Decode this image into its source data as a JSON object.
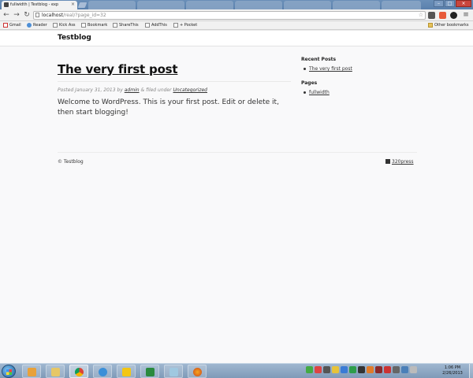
{
  "browser": {
    "active_tab": {
      "title": "fullwidth | Testblog - exp",
      "close": "×"
    },
    "window_controls": {
      "minimize": "–",
      "maximize": "□",
      "close": "×"
    },
    "nav": {
      "back": "←",
      "forward": "→",
      "reload": "↻"
    },
    "omnibox": {
      "host": "localhost",
      "path": "/real/?page_id=32",
      "star": "☆"
    },
    "bookmarks": [
      {
        "label": "Gmail",
        "icon": "gmail-icon"
      },
      {
        "label": "Reader",
        "icon": "reader-icon"
      },
      {
        "label": "Kick Ass",
        "icon": "page-icon"
      },
      {
        "label": "Bookmark",
        "icon": "page-icon"
      },
      {
        "label": "ShareThis",
        "icon": "page-icon"
      },
      {
        "label": "AddThis",
        "icon": "page-icon"
      },
      {
        "label": "+ Pocket",
        "icon": "page-icon"
      }
    ],
    "other_bookmarks": "Other bookmarks"
  },
  "site": {
    "title": "Testblog",
    "post": {
      "title": "The very first post",
      "meta_prefix": "Posted January 31, 2013 by",
      "author": "admin",
      "meta_mid": "& filed under",
      "category": "Uncategorized",
      "body": "Welcome to WordPress. This is your first post. Edit or delete it, then start blogging!"
    },
    "sidebar": {
      "recent_posts_title": "Recent Posts",
      "recent_posts": [
        "The very first post"
      ],
      "pages_title": "Pages",
      "pages": [
        "fullwidth"
      ]
    },
    "footer": {
      "copyright": "© Testblog",
      "credit": "320press"
    }
  },
  "taskbar": {
    "clock_time": "1:06 PM",
    "clock_date": "2/26/2013"
  },
  "colors": {
    "tabstrip": "#5a80ad",
    "page_bg": "#f9f9fa",
    "taskbar": "#7f9ab8"
  }
}
